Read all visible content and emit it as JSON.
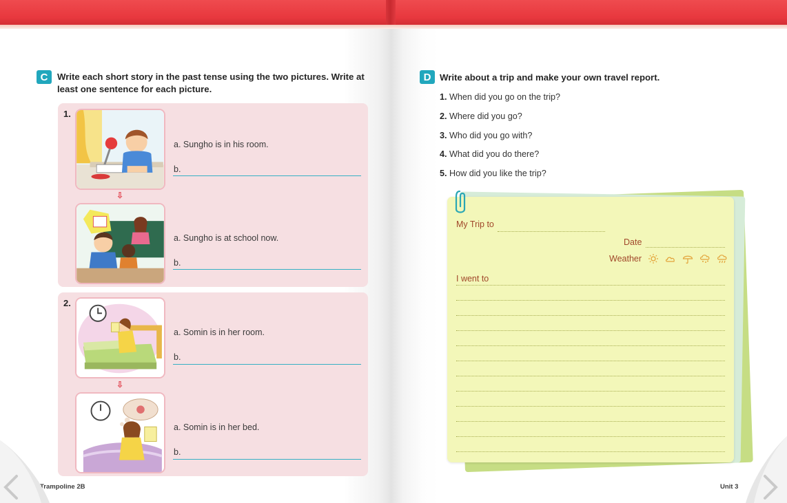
{
  "left_page": {
    "section_c": {
      "badge": "C",
      "instruction_line1": "Write each short story in the past tense using the two pictures. Write at",
      "instruction_line2": "least one sentence for each picture.",
      "exercises": [
        {
          "number": "1.",
          "pictures": [
            {
              "a": "a. Sungho is in his room.",
              "b": "b."
            },
            {
              "a": "a. Sungho is at school now.",
              "b": "b."
            }
          ]
        },
        {
          "number": "2.",
          "pictures": [
            {
              "a": "a. Somin is in her room.",
              "b": "b."
            },
            {
              "a": "a. Somin is in her bed.",
              "b": "b."
            }
          ]
        }
      ],
      "arrow_glyph": "⇩"
    },
    "footer": "Trampoline 2B"
  },
  "right_page": {
    "section_d": {
      "badge": "D",
      "instruction": "Write about a trip and make your own travel report.",
      "questions": [
        {
          "num": "1.",
          "text": "When did you go on the trip?"
        },
        {
          "num": "2.",
          "text": "Where did you go?"
        },
        {
          "num": "3.",
          "text": "Who did you go with?"
        },
        {
          "num": "4.",
          "text": "What did you do there?"
        },
        {
          "num": "5.",
          "text": "How did you like the trip?"
        }
      ]
    },
    "report_card": {
      "my_trip_label": "My Trip to",
      "date_label": "Date",
      "weather_label": "Weather",
      "weather_icons": [
        "sun-icon",
        "cloud-icon",
        "umbrella-icon",
        "snow-icon",
        "rain-cloud-icon"
      ],
      "went_label": "I went to"
    },
    "footer": "Unit 3"
  },
  "colors": {
    "header_red": "#e8383e",
    "badge_teal": "#21a7bd",
    "panel_pink": "#f6dfe2",
    "card_yellow": "#f3f7b9",
    "label_brown": "#a0472a"
  }
}
